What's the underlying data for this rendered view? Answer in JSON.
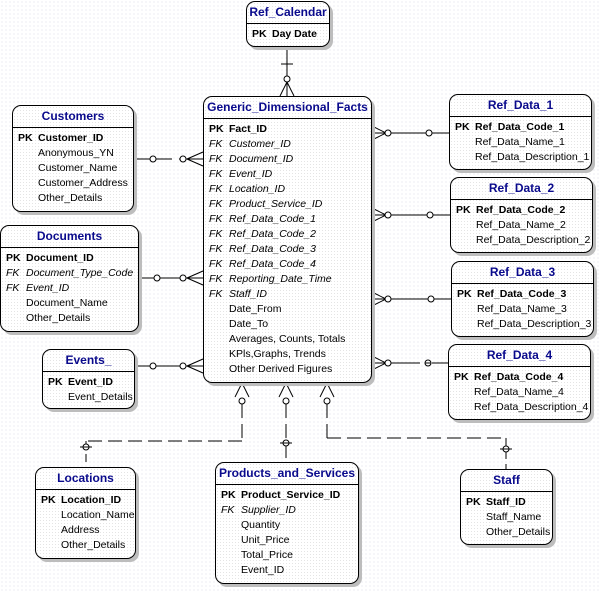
{
  "diagram_title": "",
  "entities": {
    "ref_calendar": {
      "title": "Ref_Calendar",
      "rows": [
        {
          "key": "PK",
          "name": "Day Date",
          "type": "pk"
        }
      ]
    },
    "customers": {
      "title": "Customers",
      "rows": [
        {
          "key": "PK",
          "name": "Customer_ID",
          "type": "pk"
        },
        {
          "key": "",
          "name": "Anonymous_YN",
          "type": "attr"
        },
        {
          "key": "",
          "name": "Customer_Name",
          "type": "attr"
        },
        {
          "key": "",
          "name": "Customer_Address",
          "type": "attr"
        },
        {
          "key": "",
          "name": "Other_Details",
          "type": "attr"
        }
      ]
    },
    "documents": {
      "title": "Documents",
      "rows": [
        {
          "key": "PK",
          "name": "Document_ID",
          "type": "pk"
        },
        {
          "key": "FK",
          "name": "Document_Type_Code",
          "type": "fk"
        },
        {
          "key": "FK",
          "name": "Event_ID",
          "type": "fk"
        },
        {
          "key": "",
          "name": "Document_Name",
          "type": "attr"
        },
        {
          "key": "",
          "name": "Other_Details",
          "type": "attr"
        }
      ]
    },
    "events": {
      "title": "Events_",
      "rows": [
        {
          "key": "PK",
          "name": "Event_ID",
          "type": "pk"
        },
        {
          "key": "",
          "name": "Event_Details",
          "type": "attr"
        }
      ]
    },
    "facts": {
      "title": "Generic_Dimensional_Facts",
      "rows": [
        {
          "key": "PK",
          "name": "Fact_ID",
          "type": "pk"
        },
        {
          "key": "FK",
          "name": "Customer_ID",
          "type": "fk"
        },
        {
          "key": "FK",
          "name": "Document_ID",
          "type": "fk"
        },
        {
          "key": "FK",
          "name": "Event_ID",
          "type": "fk"
        },
        {
          "key": "FK",
          "name": "Location_ID",
          "type": "fk"
        },
        {
          "key": "FK",
          "name": "Product_Service_ID",
          "type": "fk"
        },
        {
          "key": "FK",
          "name": "Ref_Data_Code_1",
          "type": "fk"
        },
        {
          "key": "FK",
          "name": "Ref_Data_Code_2",
          "type": "fk"
        },
        {
          "key": "FK",
          "name": "Ref_Data_Code_3",
          "type": "fk"
        },
        {
          "key": "FK",
          "name": "Ref_Data_Code_4",
          "type": "fk"
        },
        {
          "key": "FK",
          "name": "Reporting_Date_Time",
          "type": "fk"
        },
        {
          "key": "FK",
          "name": "Staff_ID",
          "type": "fk"
        },
        {
          "key": "",
          "name": "Date_From",
          "type": "attr"
        },
        {
          "key": "",
          "name": "Date_To",
          "type": "attr"
        },
        {
          "key": "",
          "name": "Averages, Counts, Totals",
          "type": "attr"
        },
        {
          "key": "",
          "name": "KPls,Graphs, Trends",
          "type": "attr"
        },
        {
          "key": "",
          "name": "Other Derived Figures",
          "type": "attr"
        }
      ]
    },
    "ref_data_1": {
      "title": "Ref_Data_1",
      "rows": [
        {
          "key": "PK",
          "name": "Ref_Data_Code_1",
          "type": "pk"
        },
        {
          "key": "",
          "name": "Ref_Data_Name_1",
          "type": "attr"
        },
        {
          "key": "",
          "name": "Ref_Data_Description_1",
          "type": "attr"
        }
      ]
    },
    "ref_data_2": {
      "title": "Ref_Data_2",
      "rows": [
        {
          "key": "PK",
          "name": "Ref_Data_Code_2",
          "type": "pk"
        },
        {
          "key": "",
          "name": "Ref_Data_Name_2",
          "type": "attr"
        },
        {
          "key": "",
          "name": "Ref_Data_Description_2",
          "type": "attr"
        }
      ]
    },
    "ref_data_3": {
      "title": "Ref_Data_3",
      "rows": [
        {
          "key": "PK",
          "name": "Ref_Data_Code_3",
          "type": "pk"
        },
        {
          "key": "",
          "name": "Ref_Data_Name_3",
          "type": "attr"
        },
        {
          "key": "",
          "name": "Ref_Data_Description_3",
          "type": "attr"
        }
      ]
    },
    "ref_data_4": {
      "title": "Ref_Data_4",
      "rows": [
        {
          "key": "PK",
          "name": "Ref_Data_Code_4",
          "type": "pk"
        },
        {
          "key": "",
          "name": "Ref_Data_Name_4",
          "type": "attr"
        },
        {
          "key": "",
          "name": "Ref_Data_Description_4",
          "type": "attr"
        }
      ]
    },
    "locations": {
      "title": "Locations",
      "rows": [
        {
          "key": "PK",
          "name": "Location_ID",
          "type": "pk"
        },
        {
          "key": "",
          "name": "Location_Name",
          "type": "attr"
        },
        {
          "key": "",
          "name": "Address",
          "type": "attr"
        },
        {
          "key": "",
          "name": "Other_Details",
          "type": "attr"
        }
      ]
    },
    "products": {
      "title": "Products_and_Services",
      "rows": [
        {
          "key": "PK",
          "name": "Product_Service_ID",
          "type": "pk"
        },
        {
          "key": "FK",
          "name": "Supplier_ID",
          "type": "fk"
        },
        {
          "key": "",
          "name": "Quantity",
          "type": "attr"
        },
        {
          "key": "",
          "name": "Unit_Price",
          "type": "attr"
        },
        {
          "key": "",
          "name": "Total_Price",
          "type": "attr"
        },
        {
          "key": "",
          "name": "Event_ID",
          "type": "attr"
        }
      ]
    },
    "staff": {
      "title": "Staff",
      "rows": [
        {
          "key": "PK",
          "name": "Staff_ID",
          "type": "pk"
        },
        {
          "key": "",
          "name": "Staff_Name",
          "type": "attr"
        },
        {
          "key": "",
          "name": "Other_Details",
          "type": "attr"
        }
      ]
    }
  },
  "relationships": [
    {
      "from": "Ref_Calendar",
      "to": "Generic_Dimensional_Facts",
      "style": "solid",
      "parent_end": "one",
      "child_end": "zero-or-many"
    },
    {
      "from": "Customers",
      "to": "Generic_Dimensional_Facts",
      "style": "solid",
      "parent_end": "zero-or-one",
      "child_end": "zero-or-many"
    },
    {
      "from": "Documents",
      "to": "Generic_Dimensional_Facts",
      "style": "solid",
      "parent_end": "zero-or-one",
      "child_end": "zero-or-many"
    },
    {
      "from": "Events_",
      "to": "Generic_Dimensional_Facts",
      "style": "solid",
      "parent_end": "zero-or-one",
      "child_end": "zero-or-many"
    },
    {
      "from": "Ref_Data_1",
      "to": "Generic_Dimensional_Facts",
      "style": "solid",
      "parent_end": "zero-or-one",
      "child_end": "zero-or-many"
    },
    {
      "from": "Ref_Data_2",
      "to": "Generic_Dimensional_Facts",
      "style": "solid",
      "parent_end": "zero-or-one",
      "child_end": "zero-or-many"
    },
    {
      "from": "Ref_Data_3",
      "to": "Generic_Dimensional_Facts",
      "style": "solid",
      "parent_end": "zero-or-one",
      "child_end": "zero-or-many"
    },
    {
      "from": "Ref_Data_4",
      "to": "Generic_Dimensional_Facts",
      "style": "solid",
      "parent_end": "zero-or-one",
      "child_end": "zero-or-many"
    },
    {
      "from": "Locations",
      "to": "Generic_Dimensional_Facts",
      "style": "dashed",
      "parent_end": "zero-or-one",
      "child_end": "zero-or-many"
    },
    {
      "from": "Products_and_Services",
      "to": "Generic_Dimensional_Facts",
      "style": "dashed",
      "parent_end": "zero-or-one",
      "child_end": "zero-or-many"
    },
    {
      "from": "Staff",
      "to": "Generic_Dimensional_Facts",
      "style": "dashed",
      "parent_end": "zero-or-one",
      "child_end": "zero-or-many"
    }
  ]
}
